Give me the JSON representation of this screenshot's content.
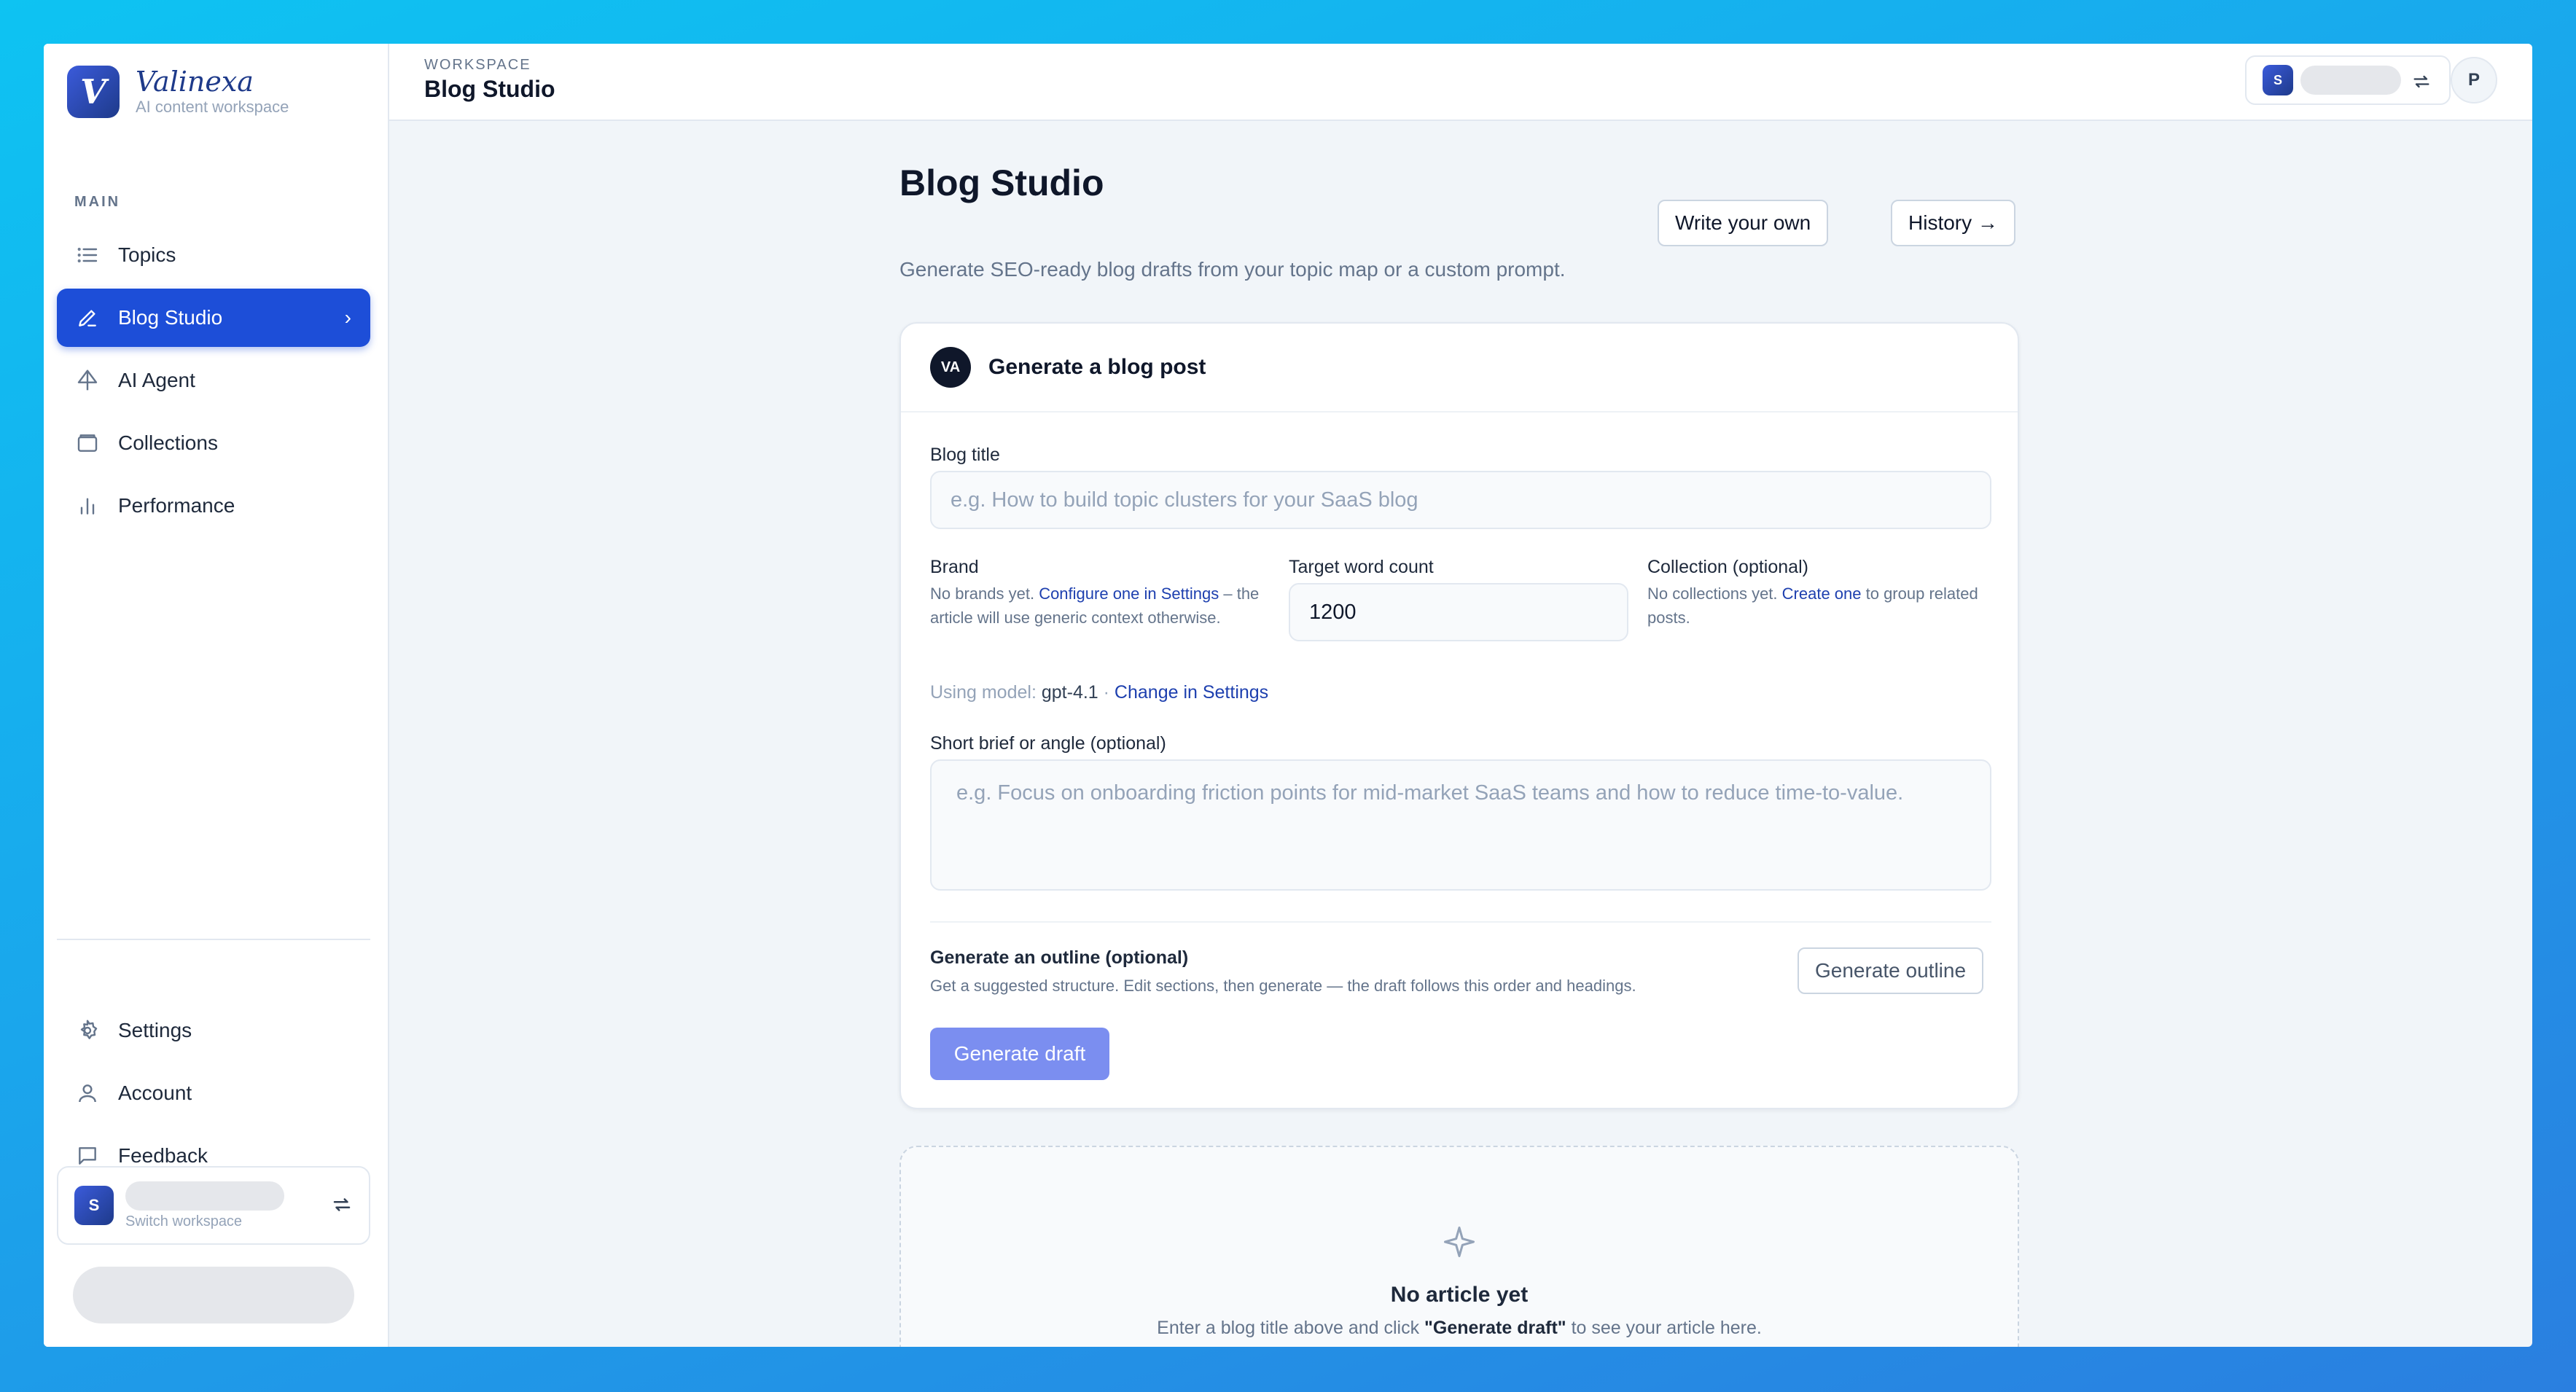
{
  "brand": {
    "name": "Valinexa",
    "tagline": "AI content workspace",
    "logo_letter": "V",
    "accent": "#1d4ed8"
  },
  "sidebar": {
    "section_label": "MAIN",
    "items": [
      {
        "label": "Topics",
        "icon": "list-icon"
      },
      {
        "label": "Blog Studio",
        "icon": "pencil-icon",
        "active": true
      },
      {
        "label": "AI Agent",
        "icon": "sail-icon"
      },
      {
        "label": "Collections",
        "icon": "folder-icon"
      },
      {
        "label": "Performance",
        "icon": "bar-chart-icon"
      }
    ],
    "bottom_items": [
      {
        "label": "Settings",
        "icon": "gear-icon"
      },
      {
        "label": "Account",
        "icon": "user-icon"
      },
      {
        "label": "Feedback",
        "icon": "message-icon"
      }
    ],
    "workspace": {
      "avatar": "S",
      "sub": "Switch workspace"
    }
  },
  "topbar": {
    "crumb": "WORKSPACE",
    "title": "Blog Studio",
    "ws_avatar": "S",
    "user_initial": "P"
  },
  "page": {
    "title": "Blog Studio",
    "subtitle": "Generate SEO-ready blog drafts from your topic map or a custom prompt.",
    "write_own": "Write your own",
    "history": "History →"
  },
  "form": {
    "avatar": "VA",
    "card_title": "Generate a blog post",
    "blog_title_label": "Blog title",
    "blog_title_placeholder": "e.g. How to build topic clusters for your SaaS blog",
    "brand_label": "Brand",
    "brand_hint_pre": "No brands yet. ",
    "brand_hint_link": "Configure one in Settings",
    "brand_hint_post": " – the article will use generic context otherwise.",
    "word_count_label": "Target word count",
    "word_count_value": "1200",
    "collection_label": "Collection (optional)",
    "collection_hint_pre": "No collections yet. ",
    "collection_hint_link": "Create one",
    "collection_hint_post": " to group related posts.",
    "model_prefix": "Using model: ",
    "model_name": "gpt-4.1",
    "model_sep": " · ",
    "model_link": "Change in Settings",
    "brief_label": "Short brief or angle (optional)",
    "brief_placeholder": "e.g. Focus on onboarding friction points for mid-market SaaS teams and how to reduce time-to-value.",
    "outline_title": "Generate an outline (optional)",
    "outline_hint": "Get a suggested structure. Edit sections, then generate — the draft follows this order and headings.",
    "outline_button": "Generate outline",
    "draft_button": "Generate draft"
  },
  "empty": {
    "title": "No article yet",
    "sub_pre": "Enter a blog title above and click ",
    "sub_bold": "\"Generate draft\"",
    "sub_post": " to see your article here."
  }
}
